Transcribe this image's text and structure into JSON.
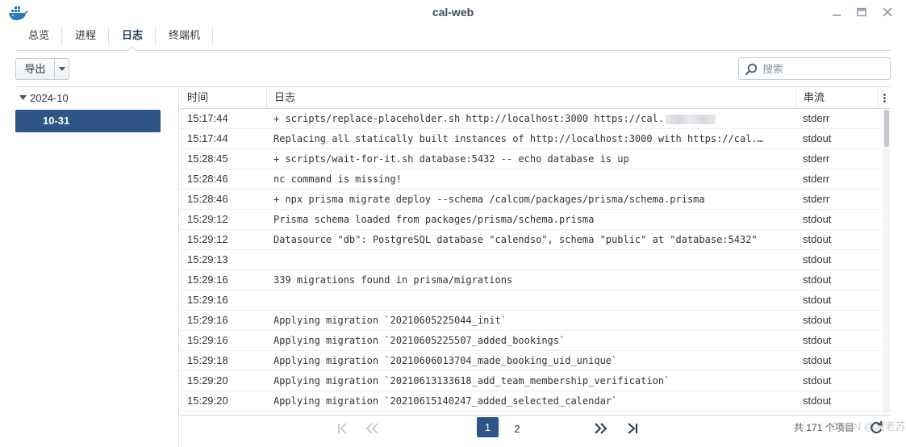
{
  "window": {
    "title": "cal-web",
    "icons": {
      "logo": "docker-whale-icon",
      "minimize": "minimize-icon",
      "maximize": "maximize-icon",
      "close": "close-icon"
    }
  },
  "tabs": [
    {
      "label": "总览",
      "active": false
    },
    {
      "label": "进程",
      "active": false
    },
    {
      "label": "日志",
      "active": true
    },
    {
      "label": "终端机",
      "active": false
    }
  ],
  "toolbar": {
    "export_label": "导出",
    "search_placeholder": "搜索"
  },
  "tree": {
    "group_label": "2024-10",
    "selected_item": "10-31"
  },
  "grid": {
    "columns": {
      "time": "时间",
      "log": "日志",
      "stream": "串流"
    },
    "rows": [
      {
        "time": "15:17:44",
        "log": "+ scripts/replace-placeholder.sh http://localhost:3000 https://cal.",
        "stream": "stderr",
        "redacted": true
      },
      {
        "time": "15:17:44",
        "log": "Replacing all statically built instances of http://localhost:3000 with https://cal.",
        "stream": "stdout",
        "redacted": true
      },
      {
        "time": "15:28:45",
        "log": "+ scripts/wait-for-it.sh database:5432 -- echo database is up",
        "stream": "stderr"
      },
      {
        "time": "15:28:46",
        "log": "nc command is missing!",
        "stream": "stderr"
      },
      {
        "time": "15:28:46",
        "log": "+ npx prisma migrate deploy --schema /calcom/packages/prisma/schema.prisma",
        "stream": "stderr"
      },
      {
        "time": "15:29:12",
        "log": "Prisma schema loaded from packages/prisma/schema.prisma",
        "stream": "stdout"
      },
      {
        "time": "15:29:12",
        "log": "Datasource \"db\": PostgreSQL database \"calendso\", schema \"public\" at \"database:5432\"",
        "stream": "stdout"
      },
      {
        "time": "15:29:13",
        "log": "",
        "stream": "stdout"
      },
      {
        "time": "15:29:16",
        "log": "339 migrations found in prisma/migrations",
        "stream": "stdout"
      },
      {
        "time": "15:29:16",
        "log": "",
        "stream": "stdout"
      },
      {
        "time": "15:29:16",
        "log": "Applying migration `20210605225044_init`",
        "stream": "stdout"
      },
      {
        "time": "15:29:16",
        "log": "Applying migration `20210605225507_added_bookings`",
        "stream": "stdout"
      },
      {
        "time": "15:29:18",
        "log": "Applying migration `20210606013704_made_booking_uid_unique`",
        "stream": "stdout"
      },
      {
        "time": "15:29:20",
        "log": "Applying migration `20210613133618_add_team_membership_verification`",
        "stream": "stdout"
      },
      {
        "time": "15:29:20",
        "log": "Applying migration `20210615140247_added_selected_calendar`",
        "stream": "stdout"
      },
      {
        "time": "",
        "log": "",
        "stream": ""
      }
    ]
  },
  "pager": {
    "pages": [
      "1",
      "2"
    ],
    "current": "1",
    "total_text": "共 171 个项目",
    "watermark": "CSDN @浦老苏"
  },
  "colors": {
    "accent": "#2f5586",
    "border": "#d7dbe0"
  }
}
